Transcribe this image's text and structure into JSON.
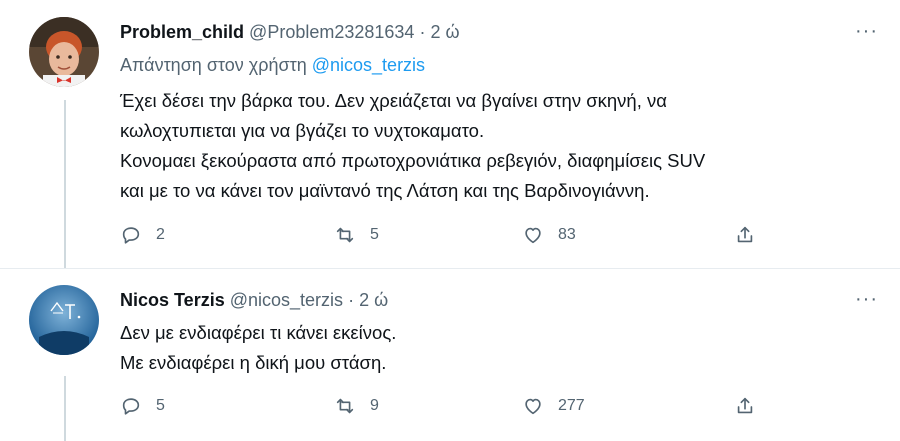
{
  "tweets": [
    {
      "display_name": "Problem_child",
      "handle": "@Problem23281634",
      "separator": "·",
      "time": "2 ώ",
      "reply_prefix": "Απάντηση στον χρήστη",
      "reply_mention": "@nicos_terzis",
      "lines": [
        "Έχει δέσει την βάρκα του. Δεν χρειάζεται να βγαίνει στην σκηνή, να",
        "κωλοχτυπιεται για να βγάζει το νυχτοκαματο.",
        "Κονομαει ξεκούραστα από πρωτοχρονιάτικα ρεβεγιόν, διαφημίσεις SUV",
        "και με το να κάνει τον μαϊντανό της Λάτση και της Βαρδινογιάννη."
      ],
      "replies": "2",
      "retweets": "5",
      "likes": "83",
      "more": "···"
    },
    {
      "display_name": "Nicos Terzis",
      "handle": "@nicos_terzis",
      "separator": "·",
      "time": "2 ώ",
      "lines": [
        "Δεν με ενδιαφέρει τι κάνει εκείνος.",
        "Με ενδιαφέρει η δική μου στάση."
      ],
      "replies": "5",
      "retweets": "9",
      "likes": "277",
      "more": "···"
    }
  ],
  "colors": {
    "accent": "#1d9bf0",
    "muted": "#536471",
    "text": "#0f1419",
    "thread_line": "#cfd9de"
  },
  "icons": [
    "reply-icon",
    "retweet-icon",
    "like-icon",
    "share-icon",
    "more-icon"
  ]
}
